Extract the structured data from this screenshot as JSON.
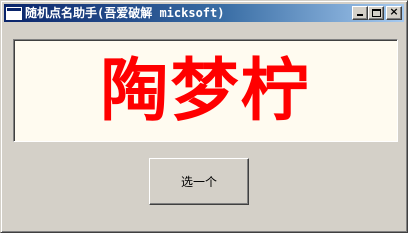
{
  "window": {
    "title": "随机点名助手(吾爱破解 micksoft)",
    "icon": "app-window-icon"
  },
  "title_buttons": {
    "minimize_icon": "minimize-icon",
    "maximize_icon": "maximize-icon",
    "close_icon": "close-icon",
    "close_glyph": "×"
  },
  "display": {
    "selected_name": "陶梦柠",
    "text_color": "#ff0000",
    "background_color": "#fffbf0"
  },
  "controls": {
    "pick_button_label": "选一个"
  },
  "colors": {
    "titlebar_start": "#0a246a",
    "titlebar_end": "#a6caf0",
    "face": "#d4d0c8"
  }
}
